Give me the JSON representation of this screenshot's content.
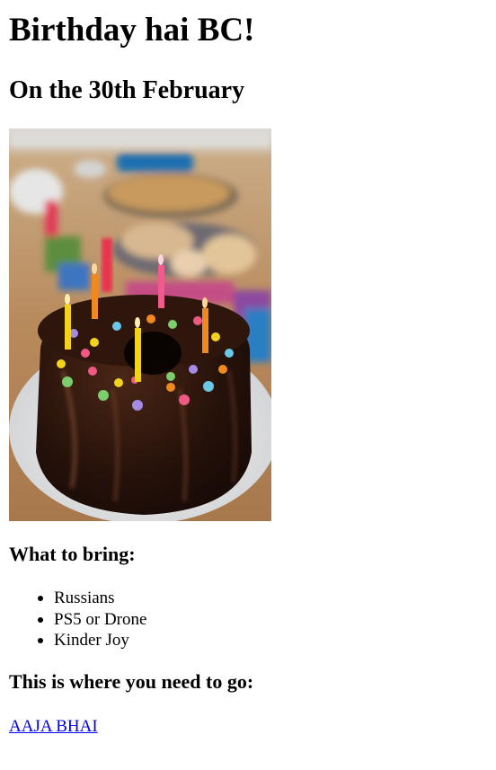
{
  "header": {
    "title": "Birthday hai BC!",
    "date_line": "On the 30th February"
  },
  "photo": {
    "description_name": "birthday-cake-photo",
    "colors": {
      "cake": "#2a140c",
      "plate": "#e9e9ea",
      "table": "#b98a5d",
      "candle_yellow": "#f3d21a",
      "candle_orange": "#f08a1e",
      "candle_pink": "#ee5b8c",
      "candle_red": "#e8344e"
    }
  },
  "bring": {
    "heading": "What to bring:",
    "items": [
      {
        "label": "Russians"
      },
      {
        "label": "PS5 or Drone"
      },
      {
        "label": "Kinder Joy"
      }
    ]
  },
  "location": {
    "heading": "This is where you need to go:",
    "link_text": "AAJA BHAI"
  },
  "theme": {
    "text_color": "#000000",
    "link_color": "#0000ee",
    "background": "#ffffff"
  }
}
